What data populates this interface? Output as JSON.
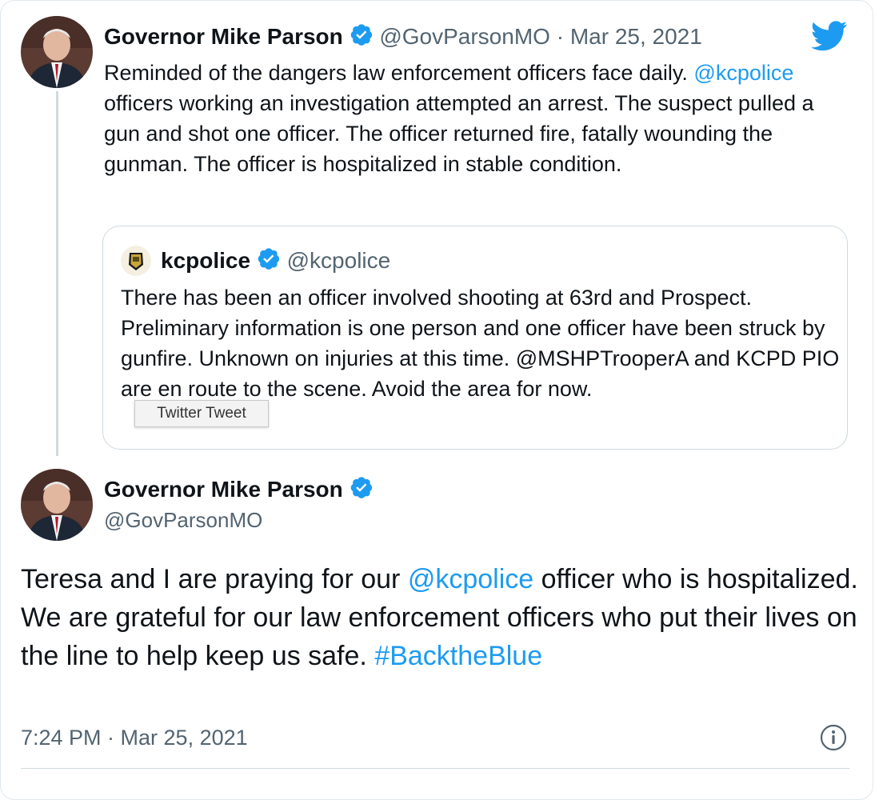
{
  "colors": {
    "link": "#1d9bf0",
    "muted": "#536471",
    "verified": "#1d9bf0",
    "border": "#cfd9de"
  },
  "tweet1": {
    "display_name": "Governor Mike Parson",
    "handle": "@GovParsonMO",
    "separator": "·",
    "date": "Mar 25, 2021",
    "text_segments": [
      {
        "text": "Reminded of the dangers law enforcement officers face daily. "
      },
      {
        "text": "@kcpolice",
        "link": true
      },
      {
        "text": " officers working an investigation attempted an arrest. The suspect pulled a gun and shot one officer. The officer returned fire, fatally wounding the gunman. The officer is hospitalized in stable condition."
      }
    ]
  },
  "quoted": {
    "display_name": "kcpolice",
    "handle": "@kcpolice",
    "text": "There has been an officer involved shooting at 63rd and Prospect.  Preliminary information is one person and one officer have been struck by gunfire.  Unknown on injuries at this time. @MSHPTrooperA and KCPD PIO are en route to the scene. Avoid the area for now."
  },
  "tooltip": {
    "text": "Twitter Tweet"
  },
  "tweet2": {
    "display_name": "Governor Mike Parson",
    "handle": "@GovParsonMO",
    "text_segments": [
      {
        "text": "Teresa and I are praying for our "
      },
      {
        "text": "@kcpolice",
        "link": true
      },
      {
        "text": " officer who is hospitalized. We are grateful for our law enforcement officers who put their lives on the line to help keep us safe. "
      },
      {
        "text": "#BacktheBlue",
        "link": true
      }
    ],
    "timestamp": "7:24 PM · Mar 25, 2021"
  },
  "icons": {
    "brand": "twitter-bird-icon",
    "verified": "verified-badge-icon",
    "info": "info-icon"
  }
}
